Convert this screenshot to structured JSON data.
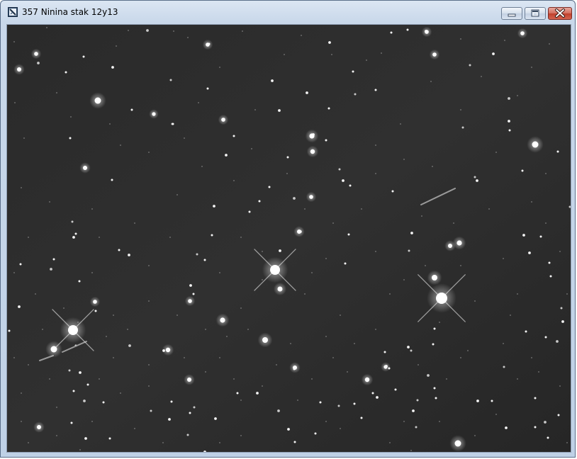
{
  "window": {
    "title": "357 Ninina stak 12y13",
    "icon": "image-app-icon"
  },
  "controls": {
    "minimize": "minimize-icon",
    "maximize": "maximize-icon",
    "close": "close-icon"
  },
  "colors": {
    "sky_background": "#2c2c2c",
    "star": "#ffffff",
    "close_button": "#c0402c"
  }
}
